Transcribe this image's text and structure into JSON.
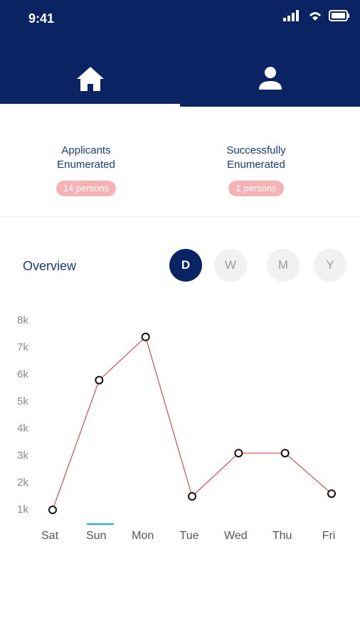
{
  "status": {
    "time": "9:41"
  },
  "tabs": [
    {
      "icon": "home-icon",
      "active": true
    },
    {
      "icon": "user-icon",
      "active": false
    }
  ],
  "stats": [
    {
      "label_line1": "Applicants",
      "label_line2": "Enumerated",
      "value": "14 persons"
    },
    {
      "label_line1": "Successfully",
      "label_line2": "Enumerated",
      "value": "1 persons"
    }
  ],
  "overview": {
    "title": "Overview",
    "periods": [
      "D",
      "W",
      "M",
      "Y"
    ],
    "active_period": "D"
  },
  "colors": {
    "brand": "#0a2463",
    "line": "#d84a4a",
    "pill_bg": "#f5b3b3",
    "accent": "#1fa3dd"
  },
  "chart_data": {
    "type": "line",
    "categories": [
      "Sat",
      "Sun",
      "Mon",
      "Tue",
      "Wed",
      "Thu",
      "Fri"
    ],
    "values": [
      1000,
      5800,
      7400,
      1500,
      3100,
      3100,
      1600
    ],
    "y_ticks": [
      "1k",
      "2k",
      "3k",
      "4k",
      "5k",
      "6k",
      "7k",
      "8k"
    ],
    "ylim": [
      1000,
      8000
    ],
    "grid": false,
    "highlighted_category": "Sun"
  }
}
